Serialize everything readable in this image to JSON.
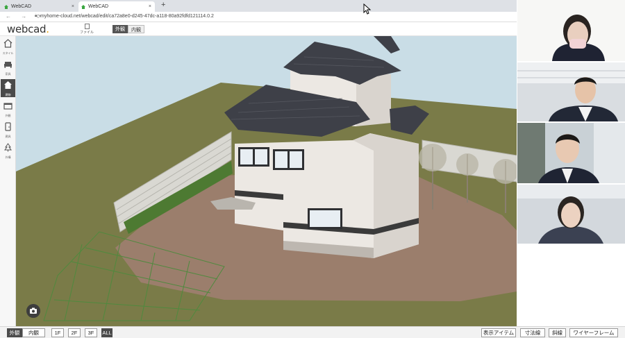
{
  "browser": {
    "tabs": [
      {
        "title": "WebCAD",
        "active": false
      },
      {
        "title": "WebCAD",
        "active": true
      }
    ],
    "new_tab": "+",
    "close_glyph": "×",
    "url": "myhome-cloud.net/webcad/edit/ca72a8e0-d245-47dc-a118-80a92fdfd121114.0.2"
  },
  "app": {
    "logo_text": "webcad",
    "logo_dot": ".",
    "file_label": "ファイル",
    "view_toggle": {
      "exterior": "外観",
      "interior": "内観"
    }
  },
  "sidebar": {
    "items": [
      {
        "label": "スタイル",
        "icon": "house-outline-icon",
        "active": false
      },
      {
        "label": "家具",
        "icon": "sofa-icon",
        "active": false
      },
      {
        "label": "建物",
        "icon": "house-filled-icon",
        "active": true
      },
      {
        "label": "外観",
        "icon": "facade-icon",
        "active": false
      },
      {
        "label": "建具",
        "icon": "door-icon",
        "active": false
      },
      {
        "label": "外構",
        "icon": "tree-icon",
        "active": false
      }
    ]
  },
  "bottom": {
    "view_toggle": {
      "exterior": "外観",
      "interior": "内観"
    },
    "floors": [
      "1F",
      "2F",
      "3F",
      "ALL"
    ],
    "selected_floor": "ALL",
    "right_buttons": [
      "表示アイテム",
      "寸法線",
      "斜線",
      "ワイヤーフレーム"
    ]
  },
  "colors": {
    "accent": "#f0a500",
    "sky": "#c9dde6",
    "lawn": "#7a7b48",
    "soil": "#9b7e6c",
    "roof": "#3e4048",
    "wall": "#ece8e3"
  }
}
